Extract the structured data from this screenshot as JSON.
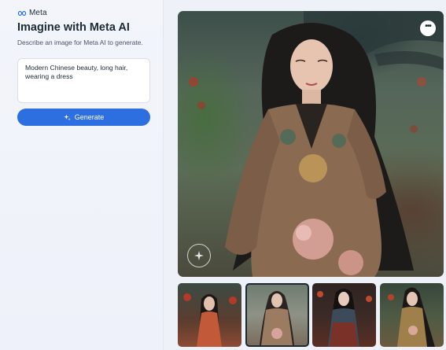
{
  "brand": {
    "name": "Meta",
    "logo_icon": "meta-infinity-icon",
    "color": "#0866ff"
  },
  "header": {
    "title": "Imagine with Meta AI",
    "subtitle": "Describe an image for Meta AI to generate."
  },
  "prompt": {
    "value": "Modern Chinese beauty, long hair, wearing a dress"
  },
  "generate_button": {
    "label": "Generate",
    "icon": "sparkle-icon",
    "color": "#2d6ee0"
  },
  "result": {
    "more_options_icon": "more-horizontal-icon",
    "watermark_icon": "imagined-with-ai-watermark",
    "thumbnails": [
      {
        "id": "thumbnail-1",
        "selected": false
      },
      {
        "id": "thumbnail-2",
        "selected": true
      },
      {
        "id": "thumbnail-3",
        "selected": false
      },
      {
        "id": "thumbnail-4",
        "selected": false
      }
    ]
  }
}
